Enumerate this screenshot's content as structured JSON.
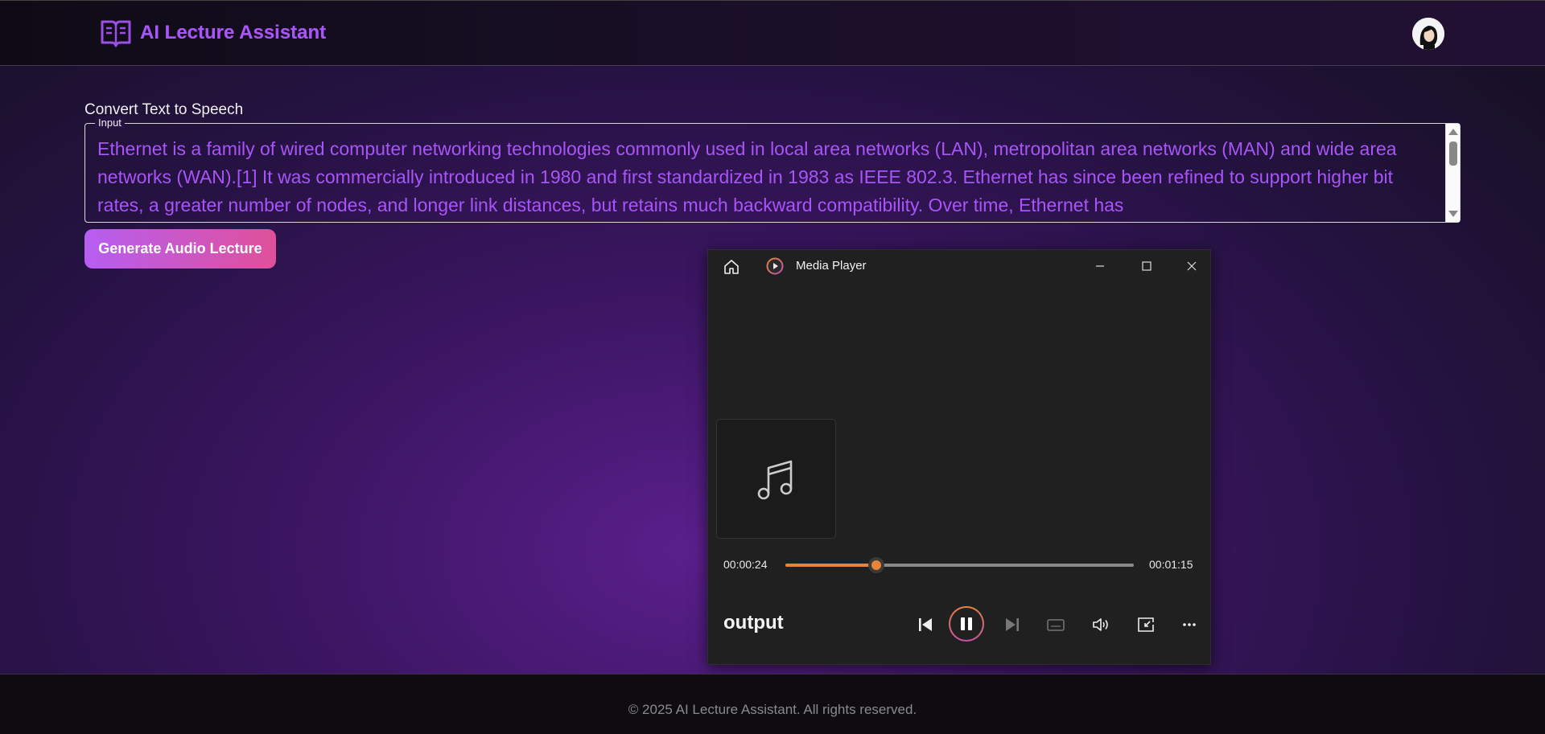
{
  "app": {
    "title": "AI Lecture Assistant"
  },
  "main": {
    "section_title": "Convert Text to Speech",
    "input_label": "Input",
    "input_text": "Ethernet is a family of wired computer networking technologies commonly used in local area networks (LAN), metropolitan area networks (MAN) and wide area networks (WAN).[1] It was commercially introduced in 1980 and first standardized in 1983 as IEEE 802.3. Ethernet has since been refined to support higher bit rates, a greater number of nodes, and longer link distances, but retains much backward compatibility. Over time, Ethernet has",
    "generate_button": "Generate Audio Lecture"
  },
  "media_player": {
    "title": "Media Player",
    "current_time": "00:00:24",
    "total_time": "00:01:15",
    "progress_fraction": 0.26,
    "track_name": "output",
    "icons": [
      "home-icon",
      "media-player-logo-icon",
      "minimize-icon",
      "maximize-icon",
      "close-icon",
      "music-note-icon",
      "previous-icon",
      "pause-icon",
      "next-icon",
      "captions-icon",
      "volume-icon",
      "mini-player-icon",
      "more-icon"
    ]
  },
  "footer": {
    "copyright": "© 2025 AI Lecture Assistant. All rights reserved."
  },
  "colors": {
    "accent_purple": "#a855f7",
    "accent_orange": "#e8843a",
    "button_gradient_start": "#b65ef2",
    "button_gradient_end": "#e0509a"
  }
}
